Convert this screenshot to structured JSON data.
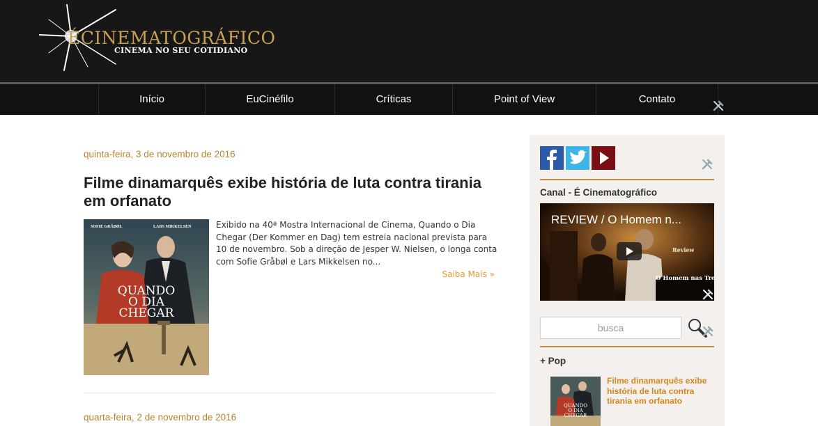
{
  "header": {
    "logo_main": "ÉCINEMATOGRÁFICO",
    "logo_tagline": "CINEMA NO SEU COTIDIANO"
  },
  "nav": {
    "items": [
      {
        "label": "Início"
      },
      {
        "label": "EuCinéfilo"
      },
      {
        "label": "Críticas"
      },
      {
        "label": "Point of View"
      },
      {
        "label": "Contato"
      }
    ]
  },
  "posts": [
    {
      "date": "quinta-feira, 3 de novembro de 2016",
      "title": "Filme dinamarquês exibe história de luta contra tirania em orfanato",
      "excerpt": "Exibido na 40ª Mostra Internacional de Cinema, Quando o Dia Chegar (Der Kommer en Dag) tem estreia nacional prevista para 10 de novembro. Sob a direção de Jesper W. Nielsen, o longa conta com Sofie Gråbøl e Lars Mikkelsen no...",
      "read_more": "Saiba Mais »",
      "poster": {
        "actor_left": "SOFIE GRÅBØL",
        "actor_right": "LARS MIKKELSEN",
        "title_line1": "QUANDO",
        "title_line2": "O DIA",
        "title_line3": "CHEGAR"
      }
    },
    {
      "date": "quarta-feira, 2 de novembro de 2016"
    }
  ],
  "sidebar": {
    "social": [
      "facebook-icon",
      "twitter-icon",
      "youtube-icon"
    ],
    "channel_heading": "Canal - É Cinematográfico",
    "video": {
      "title": "REVIEW / O Homem n...",
      "review_tag": "Review",
      "caption": "O Homem nas Trevas"
    },
    "search": {
      "placeholder": "busca"
    },
    "pop_heading": "+ Pop",
    "pop_items": [
      {
        "title": "Filme dinamarquês exibe história de luta contra tirania em orfanato"
      }
    ]
  },
  "colors": {
    "header_bg": "#171717",
    "accent_gold": "#c9a152",
    "date_color": "#b8842f",
    "link_orange": "#e29a35",
    "sidebar_bg": "#f3f0ed"
  }
}
